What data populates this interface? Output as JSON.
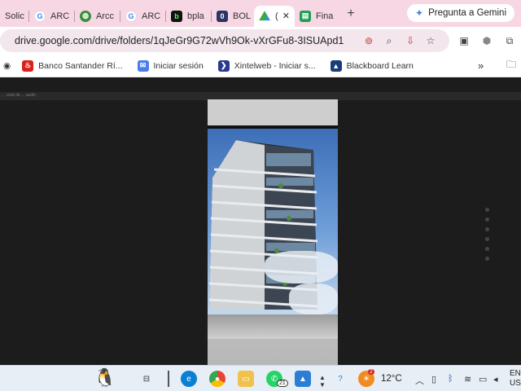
{
  "tabs": [
    {
      "label": "Solic",
      "icon": "generic-page-icon"
    },
    {
      "label": "ARC",
      "icon": "google-icon"
    },
    {
      "label": "Arcc",
      "icon": "globe-icon"
    },
    {
      "label": "ARC",
      "icon": "google-icon"
    },
    {
      "label": "bpla",
      "icon": "b-app-icon"
    },
    {
      "label": "BOL",
      "icon": "bol-icon"
    },
    {
      "label": "(",
      "icon": "google-drive-icon",
      "active": true
    },
    {
      "label": "Fina",
      "icon": "sheets-icon"
    }
  ],
  "new_tab_label": "+",
  "close_tab_label": "✕",
  "gemini_label": "Pregunta a Gemini",
  "url": "drive.google.com/drive/folders/1qJeGr9G72wVh9Ok-vXrGFu8-3ISUApd1",
  "bookmarks": [
    {
      "label": "Banco Santander Rí...",
      "icon": "santander-icon"
    },
    {
      "label": "Iniciar sesión",
      "icon": "login-icon"
    },
    {
      "label": "Xintelweb - Iniciar s...",
      "icon": "xintelweb-icon"
    },
    {
      "label": "Blackboard Learn",
      "icon": "blackboard-icon"
    }
  ],
  "bookmarks_overflow": "»",
  "preview_header": "... vista de ... audio",
  "taskbar": {
    "temperature": "12°C",
    "lang_line1": "ENG",
    "lang_line2": "US",
    "whatsapp_badge": "21",
    "weather_badge": "2"
  },
  "colors": {
    "tabstrip": "#f7d7e3",
    "omnibox": "#f3e6ec",
    "viewer_bg": "#1c1c1c",
    "taskbar": "#e8eef5"
  }
}
